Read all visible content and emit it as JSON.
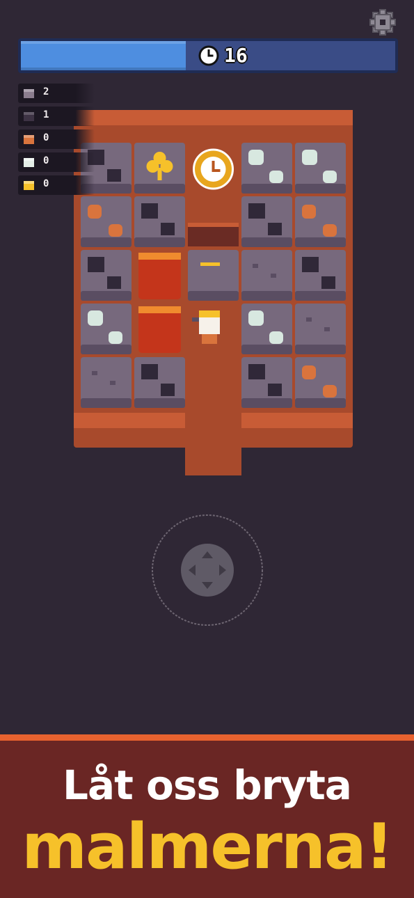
{
  "timer": {
    "seconds_label": "16",
    "fill_fraction": 0.44,
    "clock_icon": "clock-icon"
  },
  "settings": {
    "icon": "gear-icon"
  },
  "ores": [
    {
      "name": "stone",
      "count": "2",
      "color": "#8b7d8e"
    },
    {
      "name": "coal",
      "count": "1",
      "color": "#3d3344"
    },
    {
      "name": "copper",
      "count": "0",
      "color": "#d9743d"
    },
    {
      "name": "silver",
      "count": "0",
      "color": "#e4eee8"
    },
    {
      "name": "gold",
      "count": "0",
      "color": "#f6c12a"
    }
  ],
  "board": {
    "rows": 5,
    "cols": 5,
    "cells": [
      [
        "coal",
        "clover-pickup",
        "clock-pickup",
        "silver",
        "silver"
      ],
      [
        "copper",
        "coal",
        "pit",
        "coal",
        "copper"
      ],
      [
        "coal",
        "tnt",
        "cracked-rock",
        "stone",
        "coal"
      ],
      [
        "silver",
        "tnt",
        "player",
        "silver",
        "stone"
      ],
      [
        "stone",
        "cracked-coal",
        "path",
        "coal",
        "copper"
      ]
    ],
    "colors": {
      "rock": "#77697d",
      "rock_dark": "#5a4d62",
      "floor": "#a84a2c",
      "floor_edge": "#c85c36",
      "coal": "#302838",
      "copper": "#d9743d",
      "silver": "#d8e8e0",
      "gold": "#f6c12a"
    }
  },
  "joystick": {
    "icon": "dpad-icon"
  },
  "banner": {
    "line1": "Låt oss bryta",
    "line2": "malmerna!"
  }
}
